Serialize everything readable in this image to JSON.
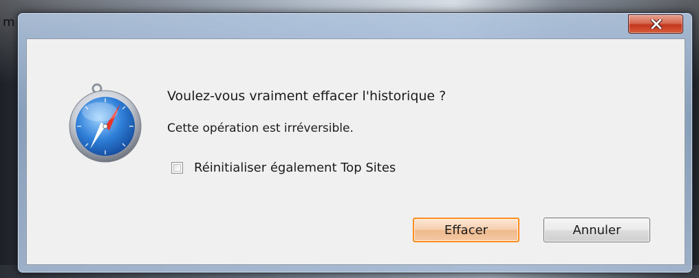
{
  "dialog": {
    "question": "Voulez-vous vraiment effacer l'historique ?",
    "detail": "Cette opération est irréversible.",
    "checkbox_label": "Réinitialiser également Top Sites",
    "checkbox_checked": false,
    "confirm_label": "Effacer",
    "cancel_label": "Annuler",
    "app_icon": "safari-compass-icon",
    "close_icon": "close-icon"
  },
  "background": {
    "partial_text": "m"
  },
  "colors": {
    "default_button_border": "#ff8c1a",
    "close_button": "#c2371e",
    "client_background": "#f0f0f0"
  }
}
